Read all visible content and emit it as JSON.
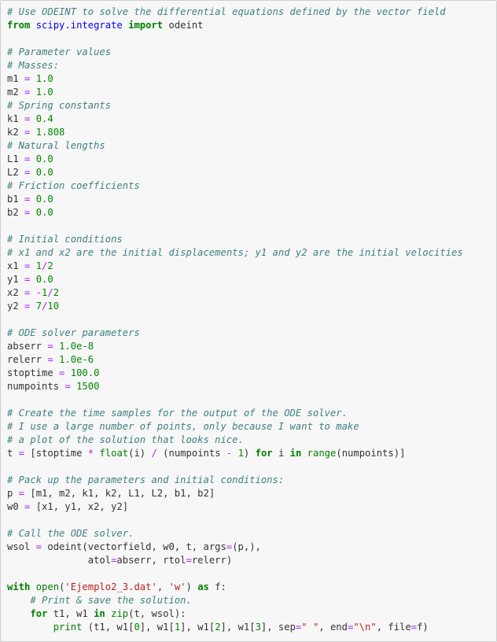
{
  "code_lines": [
    "# Use ODEINT to solve the differential equations defined by the vector field",
    "from scipy.integrate import odeint",
    "",
    "# Parameter values",
    "# Masses:",
    "m1 = 1.0",
    "m2 = 1.0",
    "# Spring constants",
    "k1 = 0.4",
    "k2 = 1.808",
    "# Natural lengths",
    "L1 = 0.0",
    "L2 = 0.0",
    "# Friction coefficients",
    "b1 = 0.0",
    "b2 = 0.0",
    "",
    "# Initial conditions",
    "# x1 and x2 are the initial displacements; y1 and y2 are the initial velocities",
    "x1 = 1/2",
    "y1 = 0.0",
    "x2 = -1/2",
    "y2 = 7/10",
    "",
    "# ODE solver parameters",
    "abserr = 1.0e-8",
    "relerr = 1.0e-6",
    "stoptime = 100.0",
    "numpoints = 1500",
    "",
    "# Create the time samples for the output of the ODE solver.",
    "# I use a large number of points, only because I want to make",
    "# a plot of the solution that looks nice.",
    "t = [stoptime * float(i) / (numpoints - 1) for i in range(numpoints)]",
    "",
    "# Pack up the parameters and initial conditions:",
    "p = [m1, m2, k1, k2, L1, L2, b1, b2]",
    "w0 = [x1, y1, x2, y2]",
    "",
    "# Call the ODE solver.",
    "wsol = odeint(vectorfield, w0, t, args=(p,),",
    "              atol=abserr, rtol=relerr)",
    "",
    "with open('Ejemplo2_3.dat', 'w') as f:",
    "    # Print & save the solution.",
    "    for t1, w1 in zip(t, wsol):",
    "        print (t1, w1[0], w1[1], w1[2], w1[3], sep=\" \", end=\"\\n\", file=f)"
  ],
  "colors": {
    "background": "#f7f7f7",
    "border": "#cfcfcf",
    "comment": "#408080",
    "keyword": "#008000",
    "operator": "#aa22ff",
    "number": "#008800",
    "string": "#ba2121",
    "module": "#0000ff"
  }
}
